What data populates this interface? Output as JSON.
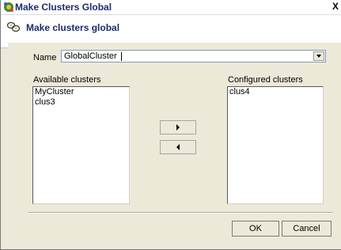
{
  "window": {
    "title": "Make Clusters Global",
    "close_glyph": "X"
  },
  "header": {
    "title": "Make clusters global"
  },
  "form": {
    "name_label": "Name",
    "name_value": "GlobalCluster"
  },
  "available": {
    "label": "Available clusters",
    "items": [
      "MyCluster",
      "clus3"
    ]
  },
  "configured": {
    "label": "Configured clusters",
    "items": [
      "clus4"
    ]
  },
  "buttons": {
    "ok": "OK",
    "cancel": "Cancel"
  },
  "icons": {
    "title": "cluster-app-icon",
    "header": "cluster-link-icon",
    "move_right": "arrow-right-icon",
    "move_left": "arrow-left-icon",
    "dropdown": "chevron-down-icon"
  }
}
